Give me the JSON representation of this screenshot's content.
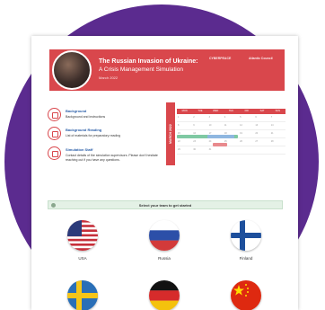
{
  "banner": {
    "title": "The Russian Invasion of Ukraine:",
    "subtitle": "A Crisis Management Simulation",
    "date": "March 2022",
    "logo_left": "CYBERPEACE",
    "logo_right": "Atlantic Council"
  },
  "resources": [
    {
      "title": "Background",
      "desc": "Background and instructions"
    },
    {
      "title": "Background Reading",
      "desc": "List of materials for preparatory reading"
    },
    {
      "title": "Simulation Staff",
      "desc": "Contact details of the simulation supervisors. Please don't hesitate reaching out if you have any questions."
    }
  ],
  "calendar": {
    "side_label": "MARCH 2022",
    "days": [
      "MON",
      "TUE",
      "WED",
      "THU",
      "FRI",
      "SAT",
      "SUN"
    ],
    "rows": [
      [
        "1",
        "2",
        "3",
        "4",
        "5",
        "6",
        "7"
      ],
      [
        "8",
        "9",
        "10",
        "11",
        "12",
        "13",
        "14"
      ],
      [
        "15",
        "16",
        "17",
        "18",
        "19",
        "20",
        "21"
      ],
      [
        "22",
        "23",
        "24",
        "25",
        "26",
        "27",
        "28"
      ],
      [
        "29",
        "30",
        "31",
        "",
        "",
        "",
        ""
      ]
    ],
    "colors": {
      "green": "#7fc9a3",
      "blue": "#8fb7e0",
      "red": "#e88a8d"
    }
  },
  "select_prompt": "Select your team to get started",
  "teams": [
    {
      "name": "USA",
      "flag": "usa-flag-icon"
    },
    {
      "name": "Russia",
      "flag": "russia-flag-icon"
    },
    {
      "name": "Finland",
      "flag": "finland-flag-icon"
    },
    {
      "name": "",
      "flag": "sweden-flag-icon"
    },
    {
      "name": "",
      "flag": "germany-flag-icon"
    },
    {
      "name": "",
      "flag": "china-flag-icon"
    }
  ]
}
